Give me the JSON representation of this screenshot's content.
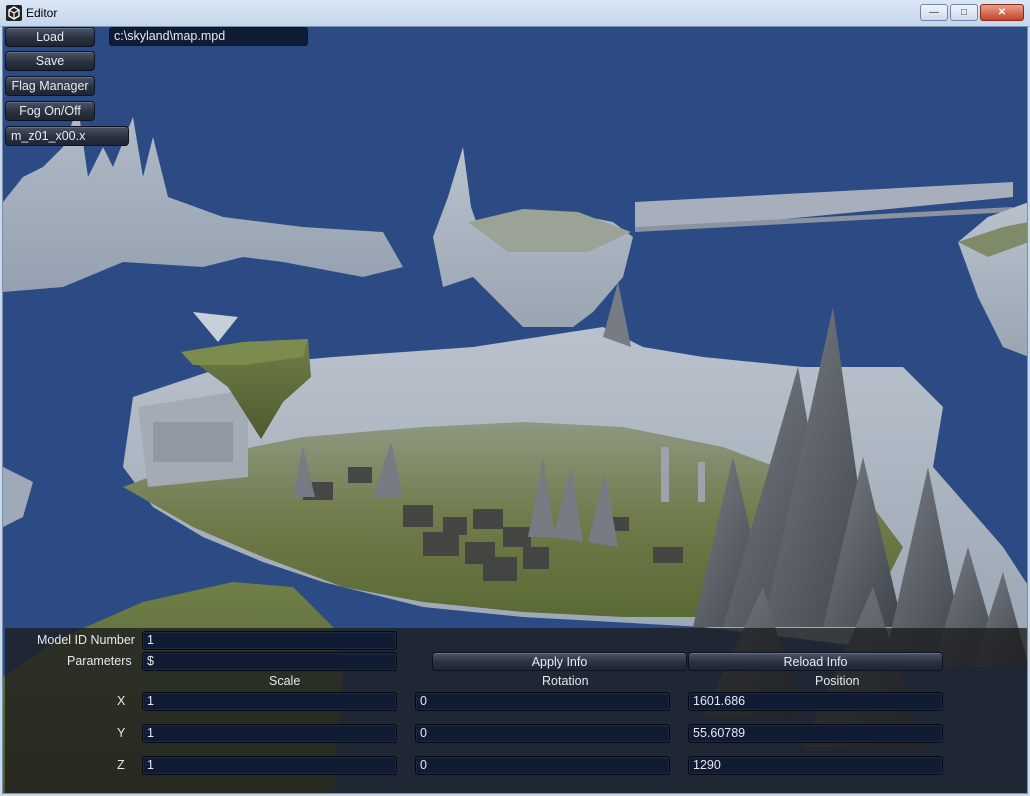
{
  "window": {
    "title": "Editor",
    "minimize_icon": "minimize-icon",
    "maximize_icon": "maximize-icon",
    "close_icon": "close-icon"
  },
  "toolbar": {
    "load_label": "Load",
    "save_label": "Save",
    "flag_manager_label": "Flag Manager",
    "fog_label": "Fog On/Off",
    "model_name": "m_z01_x00.x",
    "file_path": "c:\\skyland\\map.mpd"
  },
  "inspector": {
    "model_id_label": "Model ID Number",
    "model_id_value": "1",
    "parameters_label": "Parameters",
    "parameters_value": "$",
    "apply_label": "Apply Info",
    "reload_label": "Reload Info",
    "scale_header": "Scale",
    "rotation_header": "Rotation",
    "position_header": "Position",
    "x_label": "X",
    "y_label": "Y",
    "z_label": "Z",
    "scale": {
      "x": "1",
      "y": "1",
      "z": "1"
    },
    "rotation": {
      "x": "0",
      "y": "0",
      "z": "0"
    },
    "position": {
      "x": "1601.686",
      "y": "55.60789",
      "z": "1290"
    }
  },
  "colors": {
    "sky": "#2c4a83",
    "fog": "#a9b4c2",
    "grass": "#6d7a45",
    "rock": "#5c6068",
    "panel": "#1c1c1e"
  }
}
